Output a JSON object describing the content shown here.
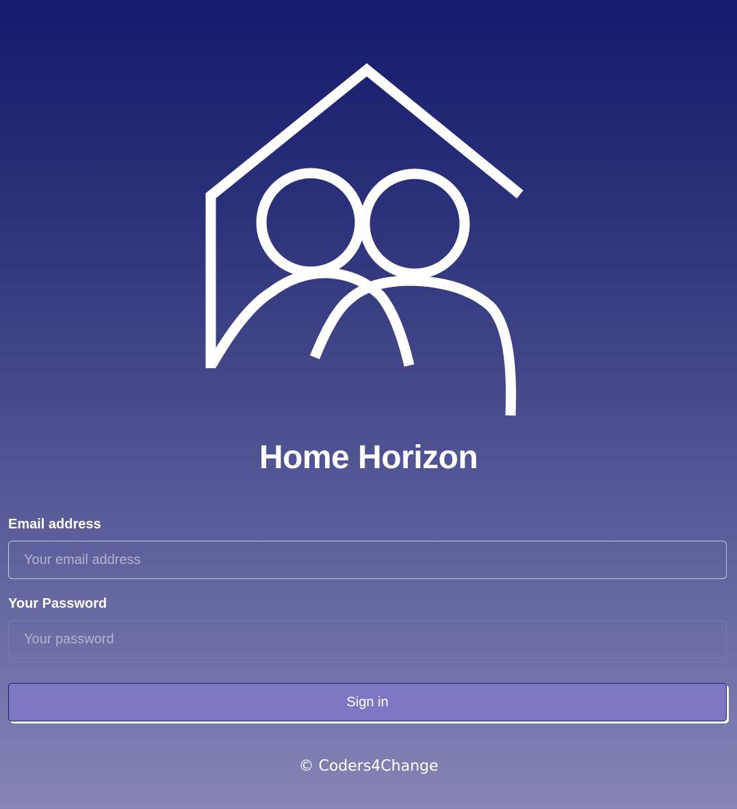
{
  "app": {
    "title": "Home Horizon",
    "logo_icon": "house-with-people-icon"
  },
  "form": {
    "email_label": "Email address",
    "email_placeholder": "Your email address",
    "email_value": "",
    "password_label": "Your Password",
    "password_placeholder": "Your password",
    "password_value": "",
    "submit_label": "Sign in"
  },
  "footer": {
    "text": "© Coders4Change"
  },
  "colors": {
    "background_top": "#141a6c",
    "background_bottom": "#8585b5",
    "button": "#7b77c3",
    "text": "#ffffff"
  }
}
